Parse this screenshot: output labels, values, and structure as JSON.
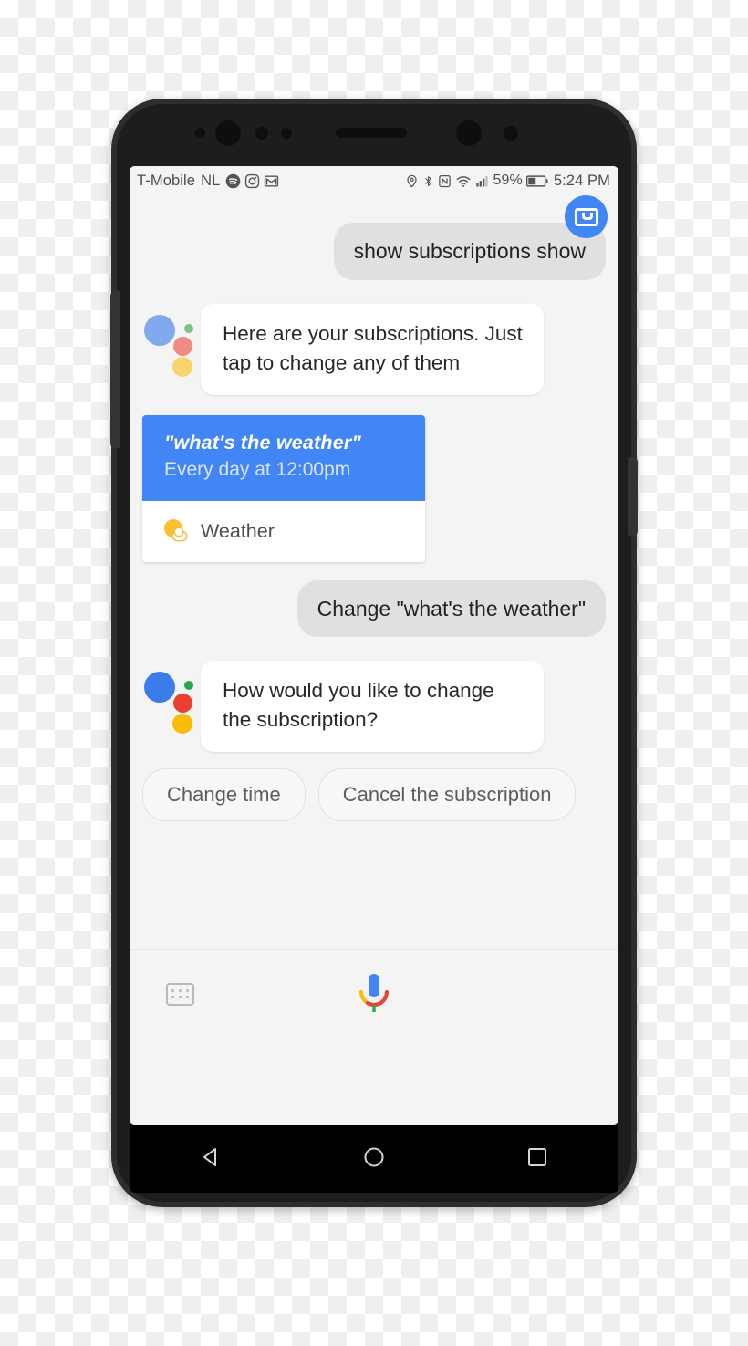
{
  "device": {
    "type": "android-phone",
    "frame_color": "#2e2e2e",
    "buttons": {
      "volume": "volume-rocker",
      "power": "power-button"
    }
  },
  "statusbar": {
    "carrier": "T-Mobile",
    "network": "NL",
    "app_icons": [
      "spotify-icon",
      "instagram-icon",
      "gmail-icon"
    ],
    "system_icons": [
      "location-icon",
      "bluetooth-icon",
      "nfc-icon",
      "wifi-icon",
      "cellular-signal-icon"
    ],
    "battery_percent": "59%",
    "battery_icon": "battery-icon",
    "clock": "5:24 PM"
  },
  "conversation": {
    "user_avatar_icon": "inbox-avatar-icon",
    "messages": [
      {
        "id": "m1",
        "from": "user",
        "text": "show subscriptions show"
      },
      {
        "id": "m2",
        "from": "assistant",
        "text": "Here are your subscriptions. Just tap to change any of them"
      },
      {
        "id": "m3",
        "from": "assistant-card",
        "card": {
          "title": "\"what's the weather\"",
          "subtitle": "Every day at 12:00pm",
          "app_icon": "weather-sun-cloud-icon",
          "app_name": "Weather",
          "header_color": "#4285f4"
        }
      },
      {
        "id": "m4",
        "from": "user",
        "text": "Change \"what's the weather\""
      },
      {
        "id": "m5",
        "from": "assistant",
        "text": "How would you like to change the subscription?"
      }
    ],
    "suggestion_chips": [
      {
        "label": "Change time"
      },
      {
        "label": "Cancel the subscription"
      }
    ]
  },
  "bottombar": {
    "keyboard_icon": "keyboard-icon",
    "mic_icon": "google-mic-icon"
  },
  "navbar": {
    "back": "back-triangle-icon",
    "home": "home-circle-icon",
    "recents": "recents-square-icon"
  },
  "colors": {
    "accent_blue": "#4285f4",
    "user_bubble": "#e0e0e0",
    "assistant_bubble": "#ffffff",
    "screen_bg": "#f4f4f4",
    "google_red": "#ea3f31",
    "google_yellow": "#fbbc05",
    "google_green": "#2aa84f"
  }
}
